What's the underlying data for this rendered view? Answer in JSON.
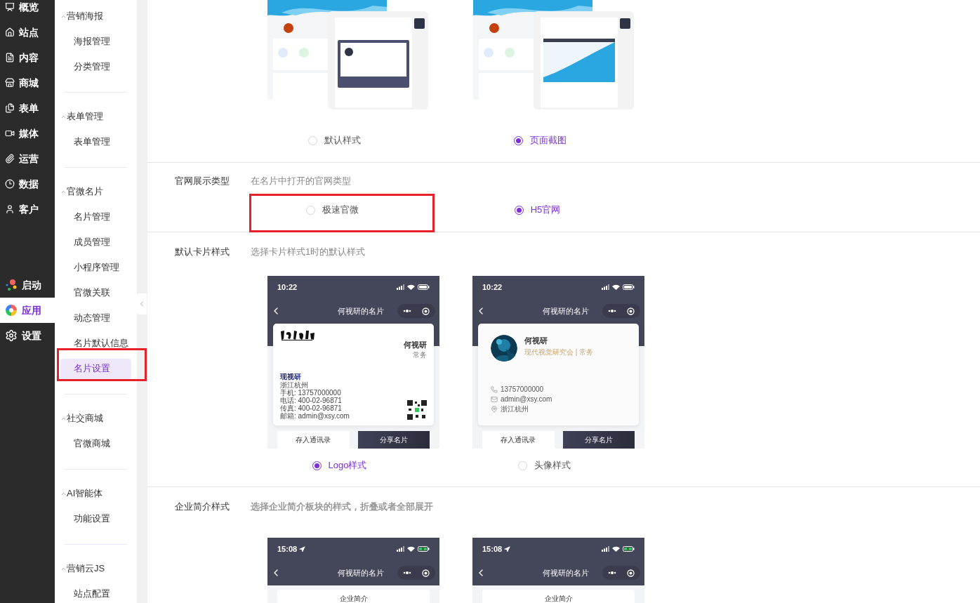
{
  "nav": [
    {
      "label": "概览",
      "selected": false
    },
    {
      "label": "站点",
      "selected": false
    },
    {
      "label": "内容",
      "selected": false
    },
    {
      "label": "商城",
      "selected": false
    },
    {
      "label": "表单",
      "selected": false
    },
    {
      "label": "媒体",
      "selected": false
    },
    {
      "label": "运营",
      "selected": false
    },
    {
      "label": "数据",
      "selected": false
    },
    {
      "label": "客户",
      "selected": false
    }
  ],
  "nav_bottom": [
    {
      "label": "启动",
      "selected": false
    },
    {
      "label": "应用",
      "selected": true
    },
    {
      "label": "设置",
      "selected": false
    }
  ],
  "submenu": [
    {
      "title": "营销海报",
      "expanded": true,
      "items": [
        {
          "label": "海报管理",
          "selected": false,
          "highlighted": false
        },
        {
          "label": "分类管理",
          "selected": false,
          "highlighted": false
        }
      ]
    },
    {
      "title": "表单管理",
      "expanded": true,
      "items": [
        {
          "label": "表单管理",
          "selected": false,
          "highlighted": false
        }
      ]
    },
    {
      "title": "官微名片",
      "expanded": true,
      "items": [
        {
          "label": "名片管理",
          "selected": false,
          "highlighted": false
        },
        {
          "label": "成员管理",
          "selected": false,
          "highlighted": false
        },
        {
          "label": "小程序管理",
          "selected": false,
          "highlighted": false
        },
        {
          "label": "官微关联",
          "selected": false,
          "highlighted": false
        },
        {
          "label": "动态管理",
          "selected": false,
          "highlighted": false
        },
        {
          "label": "名片默认信息",
          "selected": false,
          "highlighted": false
        },
        {
          "label": "名片设置",
          "selected": true,
          "highlighted": true
        }
      ]
    },
    {
      "title": "社交商城",
      "expanded": true,
      "items": [
        {
          "label": "官微商城",
          "selected": false,
          "highlighted": false
        }
      ]
    },
    {
      "title": "AI智能体",
      "expanded": true,
      "items": [
        {
          "label": "功能设置",
          "selected": false,
          "highlighted": false
        }
      ]
    },
    {
      "title": "营销云JS",
      "expanded": true,
      "items": [
        {
          "label": "站点配置",
          "selected": false,
          "highlighted": false
        }
      ]
    }
  ],
  "sections": [
    {
      "kind": "preview",
      "options": [
        {
          "label": "默认样式",
          "selected": false,
          "highlighted": false
        },
        {
          "label": "页面截图",
          "selected": true,
          "highlighted": false
        }
      ]
    },
    {
      "kind": "radio",
      "label": "官网展示类型",
      "description": "在名片中打开的官网类型",
      "options": [
        {
          "label": "极速官微",
          "selected": false,
          "highlighted": true
        },
        {
          "label": "H5官网",
          "selected": true,
          "highlighted": false
        }
      ]
    },
    {
      "kind": "phones",
      "label": "默认卡片样式",
      "description": "选择卡片样式1时的默认样式",
      "options": [
        {
          "label": "Logo样式",
          "selected": true,
          "highlighted": false,
          "phone": {
            "time": "10:22",
            "charging": false,
            "title": "何视研的名片",
            "card": {
              "kind": "logo",
              "name": "何视研",
              "role": "常务",
              "company": "现视研",
              "lines": [
                "浙江杭州",
                "手机: 13757000000",
                "电话: 400-02-96871",
                "传真: 400-02-96871",
                "邮箱: admin@xsy.com"
              ]
            },
            "buttons": [
              "存入通讯录",
              "分享名片"
            ]
          }
        },
        {
          "label": "头像样式",
          "selected": false,
          "highlighted": false,
          "phone": {
            "time": "10:22",
            "charging": false,
            "title": "何视研的名片",
            "card": {
              "kind": "avatar",
              "name": "何视研",
              "org": "现代视觉研究会 | 常务",
              "phone": "13757000000",
              "email": "admin@xsy.com",
              "location": "浙江杭州"
            },
            "buttons": [
              "存入通讯录",
              "分享名片"
            ]
          }
        }
      ]
    },
    {
      "kind": "phones",
      "label": "企业简介样式",
      "description": "选择企业简介板块的样式，折叠或者全部展开",
      "options": [
        {
          "phone": {
            "time": "15:08",
            "charging": true,
            "title": "何视研的名片",
            "card": {
              "kind": "intro",
              "heading": "企业简介"
            }
          }
        },
        {
          "phone": {
            "time": "15:08",
            "charging": true,
            "title": "何视研的名片",
            "card": {
              "kind": "intro",
              "heading": "企业简介"
            }
          }
        }
      ]
    }
  ]
}
